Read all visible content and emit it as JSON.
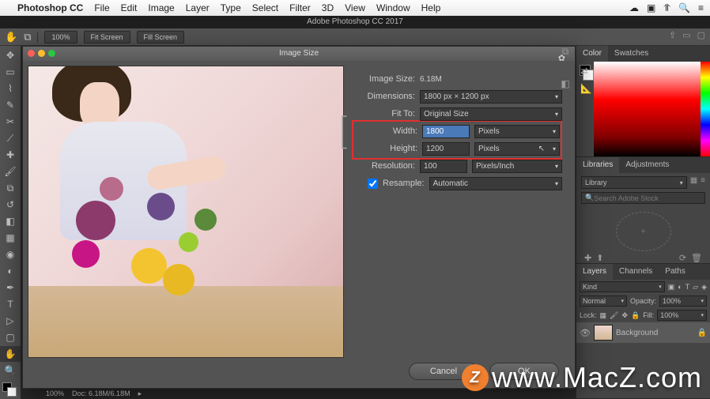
{
  "menubar": {
    "app": "Photoshop CC",
    "items": [
      "File",
      "Edit",
      "Image",
      "Layer",
      "Type",
      "Select",
      "Filter",
      "3D",
      "View",
      "Window",
      "Help"
    ]
  },
  "window_title": "Adobe Photoshop CC 2017",
  "toolbar": {
    "zoom": "100%",
    "fit1": "Fit Screen",
    "fit2": "Fill Screen"
  },
  "dialog": {
    "title": "Image Size",
    "image_size_label": "Image Size:",
    "image_size_value": "6.18M",
    "dimensions_label": "Dimensions:",
    "dimensions_value": "1800 px × 1200 px",
    "fit_to_label": "Fit To:",
    "fit_to_value": "Original Size",
    "width_label": "Width:",
    "width_value": "1800",
    "width_unit": "Pixels",
    "height_label": "Height:",
    "height_value": "1200",
    "height_unit": "Pixels",
    "resolution_label": "Resolution:",
    "resolution_value": "100",
    "resolution_unit": "Pixels/Inch",
    "resample_label": "Resample:",
    "resample_value": "Automatic",
    "cancel": "Cancel",
    "ok": "OK"
  },
  "status": {
    "zoom": "100%",
    "doc": "Doc: 6.18M/6.18M"
  },
  "panels": {
    "color_tabs": [
      "Color",
      "Swatches"
    ],
    "lib_tabs": [
      "Libraries",
      "Adjustments"
    ],
    "lib_value": "Library",
    "lib_search": "Search Adobe Stock",
    "layer_tabs": [
      "Layers",
      "Channels",
      "Paths"
    ],
    "kind": "Kind",
    "blend": "Normal",
    "opacity_label": "Opacity:",
    "opacity_value": "100%",
    "lock_label": "Lock:",
    "fill_label": "Fill:",
    "fill_value": "100%",
    "layer_name": "Background"
  },
  "watermark": "www.MacZ.com"
}
